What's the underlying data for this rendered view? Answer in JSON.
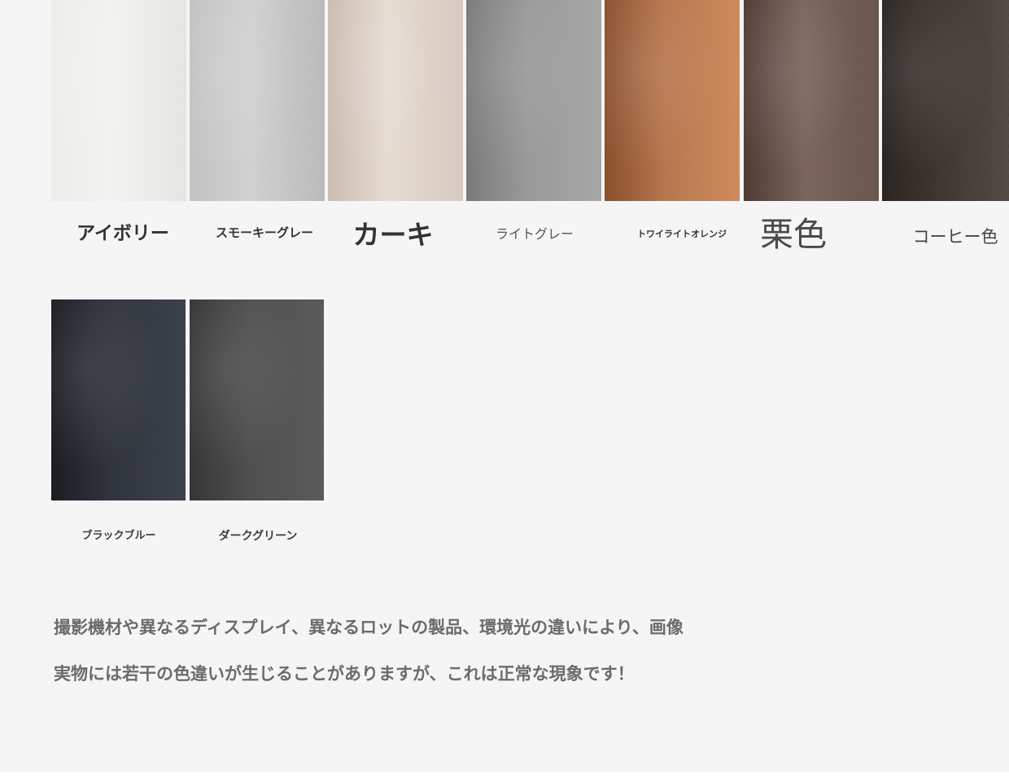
{
  "swatches": [
    {
      "name": "アイボリー",
      "colors": [
        "#eeeeeb",
        "#f4f4f2",
        "#e7e7e4"
      ]
    },
    {
      "name": "スモーキーグレー",
      "colors": [
        "#c4c4c4",
        "#d2d2d2",
        "#bcbcbc"
      ]
    },
    {
      "name": "カーキ",
      "colors": [
        "#cdbcb1",
        "#e9ddd3",
        "#d9cbc1"
      ]
    },
    {
      "name": "ライトグレー",
      "colors": [
        "#7a7a7a",
        "#9a9a9a",
        "#a7a7a7"
      ]
    },
    {
      "name": "トワイライトオレンジ",
      "colors": [
        "#8a4e2c",
        "#b8774e",
        "#d08b5c"
      ]
    },
    {
      "name": "栗色",
      "colors": [
        "#4d3b33",
        "#7a655c",
        "#6a564c"
      ]
    },
    {
      "name": "コーヒー色",
      "colors": [
        "#2a2420",
        "#3d3531",
        "#534a45"
      ]
    },
    {
      "name": "ブラックブルー",
      "colors": [
        "#1a1c22",
        "#2f333b",
        "#3b404a"
      ]
    },
    {
      "name": "ダークグリーン",
      "colors": [
        "#353535",
        "#4f4f4f",
        "#5a5a5a"
      ]
    }
  ],
  "notes": {
    "line1": "撮影機材や異なるディスプレイ、異なるロットの製品、環境光の違いにより、画像",
    "line2": "実物には若干の色違いが生じることがありますが、これは正常な現象です！"
  }
}
